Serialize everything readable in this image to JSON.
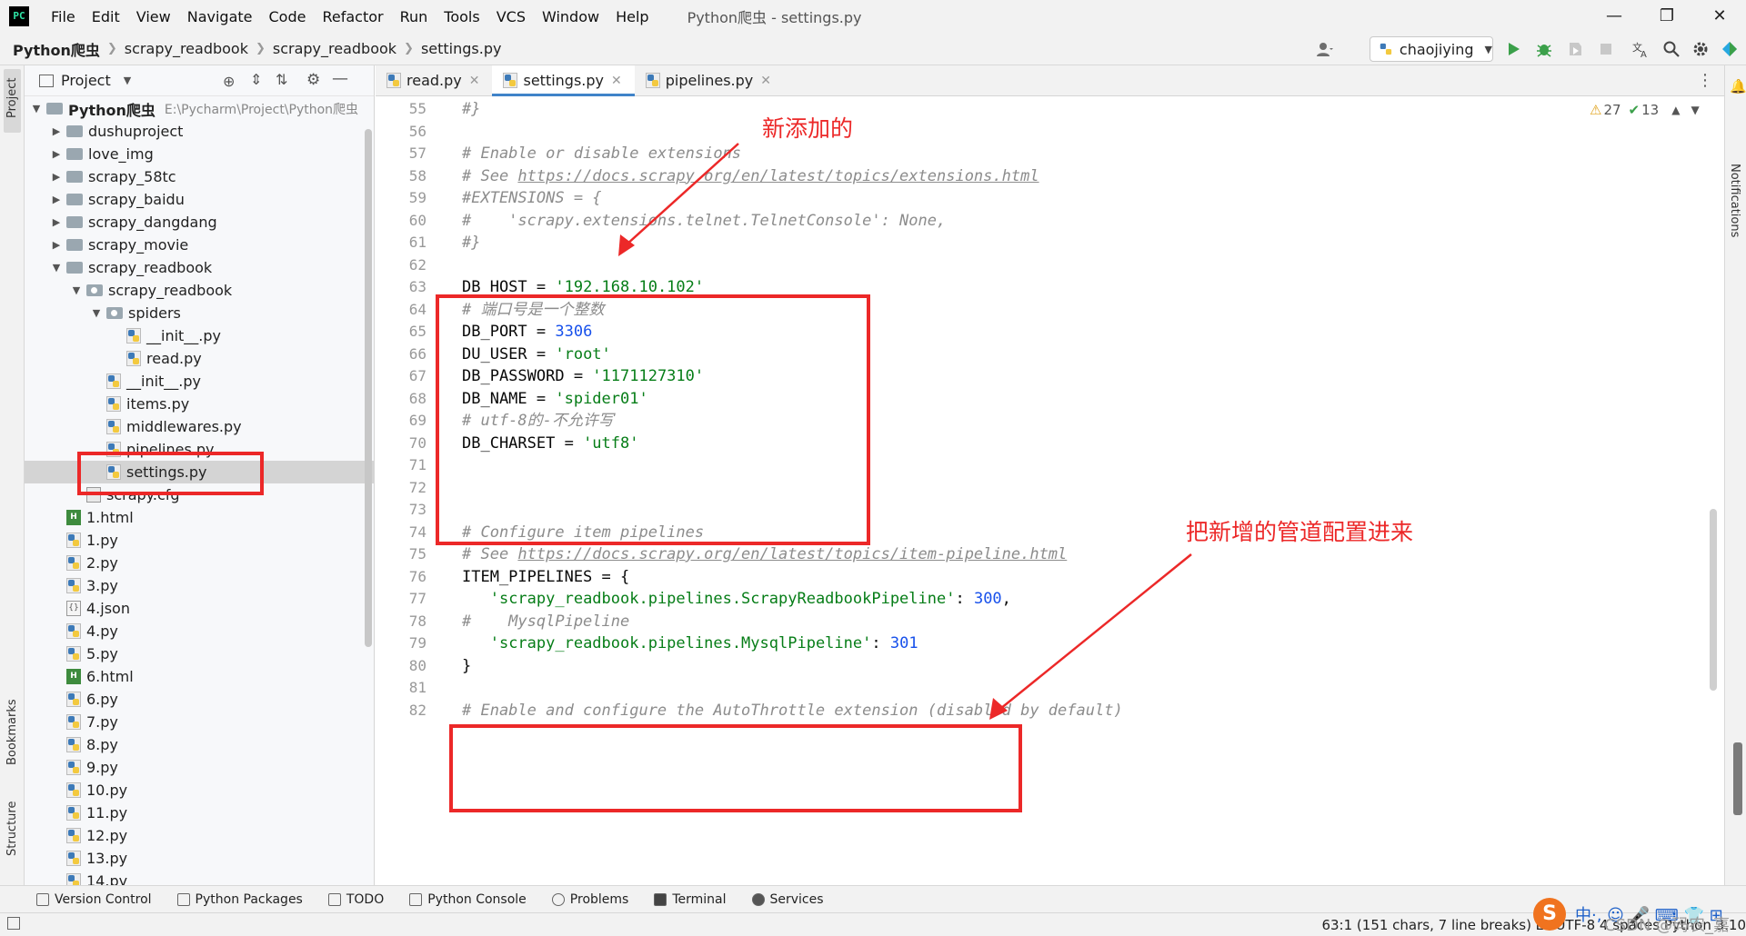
{
  "titlebar": {
    "menu": [
      "File",
      "Edit",
      "View",
      "Navigate",
      "Code",
      "Refactor",
      "Run",
      "Tools",
      "VCS",
      "Window",
      "Help"
    ],
    "window_title": "Python爬虫 - settings.py"
  },
  "navbar": {
    "breadcrumbs": [
      "Python爬虫",
      "scrapy_readbook",
      "scrapy_readbook",
      "settings.py"
    ],
    "run_config": "chaojiying"
  },
  "left_stripe": {
    "project": "Project",
    "bookmarks": "Bookmarks",
    "structure": "Structure"
  },
  "project_panel": {
    "title": "Project",
    "root_name": "Python爬虫",
    "root_path": "E:\\Pycharm\\Project\\Python爬虫",
    "items": [
      {
        "label": "dushuproject",
        "type": "folder"
      },
      {
        "label": "love_img",
        "type": "folder"
      },
      {
        "label": "scrapy_58tc",
        "type": "folder"
      },
      {
        "label": "scrapy_baidu",
        "type": "folder"
      },
      {
        "label": "scrapy_dangdang",
        "type": "folder"
      },
      {
        "label": "scrapy_movie",
        "type": "folder"
      },
      {
        "label": "scrapy_readbook",
        "type": "folder"
      },
      {
        "label": "scrapy_readbook",
        "type": "package"
      },
      {
        "label": "spiders",
        "type": "package"
      },
      {
        "label": "__init__.py",
        "type": "py"
      },
      {
        "label": "read.py",
        "type": "py"
      },
      {
        "label": "__init__.py",
        "type": "py"
      },
      {
        "label": "items.py",
        "type": "py"
      },
      {
        "label": "middlewares.py",
        "type": "py"
      },
      {
        "label": "pipelines.py",
        "type": "py"
      },
      {
        "label": "settings.py",
        "type": "py"
      },
      {
        "label": "scrapy.cfg",
        "type": "cfg"
      },
      {
        "label": "1.html",
        "type": "html"
      },
      {
        "label": "1.py",
        "type": "py"
      },
      {
        "label": "2.py",
        "type": "py"
      },
      {
        "label": "3.py",
        "type": "py"
      },
      {
        "label": "4.json",
        "type": "json"
      },
      {
        "label": "4.py",
        "type": "py"
      },
      {
        "label": "5.py",
        "type": "py"
      },
      {
        "label": "6.html",
        "type": "html"
      },
      {
        "label": "6.py",
        "type": "py"
      },
      {
        "label": "7.py",
        "type": "py"
      },
      {
        "label": "8.py",
        "type": "py"
      },
      {
        "label": "9.py",
        "type": "py"
      },
      {
        "label": "10.py",
        "type": "py"
      },
      {
        "label": "11.py",
        "type": "py"
      },
      {
        "label": "12.py",
        "type": "py"
      },
      {
        "label": "13.py",
        "type": "py"
      },
      {
        "label": "14.py",
        "type": "py"
      }
    ]
  },
  "editor": {
    "tabs": [
      {
        "label": "read.py",
        "active": false
      },
      {
        "label": "settings.py",
        "active": true
      },
      {
        "label": "pipelines.py",
        "active": false
      }
    ],
    "inspections": {
      "warnings": "27",
      "weak_warnings": "13"
    },
    "lines": [
      {
        "no": "55",
        "code": "#}"
      },
      {
        "no": "56",
        "code": ""
      },
      {
        "no": "57",
        "code": "# Enable or disable extensions"
      },
      {
        "no": "58",
        "code": "# See https://docs.scrapy.org/en/latest/topics/extensions.html"
      },
      {
        "no": "59",
        "code": "#EXTENSIONS = {"
      },
      {
        "no": "60",
        "code": "#    'scrapy.extensions.telnet.TelnetConsole': None,"
      },
      {
        "no": "61",
        "code": "#}"
      },
      {
        "no": "62",
        "code": ""
      },
      {
        "no": "63",
        "code": "DB_HOST = '192.168.10.102'"
      },
      {
        "no": "64",
        "code": "# 端口号是一个整数"
      },
      {
        "no": "65",
        "code": "DB_PORT = 3306"
      },
      {
        "no": "66",
        "code": "DU_USER = 'root'"
      },
      {
        "no": "67",
        "code": "DB_PASSWORD = '1171127310'"
      },
      {
        "no": "68",
        "code": "DB_NAME = 'spider01'"
      },
      {
        "no": "69",
        "code": "# utf-8的-不允许写"
      },
      {
        "no": "70",
        "code": "DB_CHARSET = 'utf8'"
      },
      {
        "no": "71",
        "code": ""
      },
      {
        "no": "72",
        "code": ""
      },
      {
        "no": "73",
        "code": ""
      },
      {
        "no": "74",
        "code": "# Configure item pipelines"
      },
      {
        "no": "75",
        "code": "# See https://docs.scrapy.org/en/latest/topics/item-pipeline.html"
      },
      {
        "no": "76",
        "code": "ITEM_PIPELINES = {"
      },
      {
        "no": "77",
        "code": "   'scrapy_readbook.pipelines.ScrapyReadbookPipeline': 300,"
      },
      {
        "no": "78",
        "code": "#    MysqlPipeline"
      },
      {
        "no": "79",
        "code": "   'scrapy_readbook.pipelines.MysqlPipeline': 301"
      },
      {
        "no": "80",
        "code": "}"
      },
      {
        "no": "81",
        "code": ""
      },
      {
        "no": "82",
        "code": "# Enable and configure the AutoThrottle extension (disabled by default)"
      }
    ]
  },
  "annotations": {
    "new_added": "新添加的",
    "pipeline_note": "把新增的管道配置进来"
  },
  "right_stripe": {
    "notifications": "Notifications"
  },
  "bottom_tools": [
    "Version Control",
    "Python Packages",
    "TODO",
    "Python Console",
    "Problems",
    "Terminal",
    "Services"
  ],
  "statusbar": {
    "text": "63:1 (151 chars, 7 line breaks)   LF   UTF-8   4 spaces   Python 3.10"
  },
  "overlay": {
    "ime": "中·, ☺ 🎤 ⌨ 👕 ⊞",
    "watermark": "CSDN @码农_嘉嘉"
  },
  "colors": {
    "accent": "#4083c9",
    "selection": "#a6d2ff",
    "annotation_red": "#ec2828",
    "string": "#067d17",
    "number": "#1750eb",
    "comment": "#8c8c8c"
  }
}
